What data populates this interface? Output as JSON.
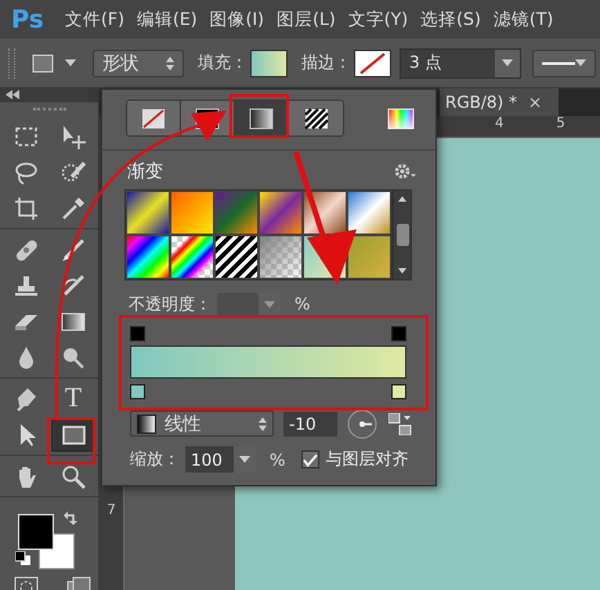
{
  "app_logo": "Ps",
  "menu": [
    "文件(F)",
    "编辑(E)",
    "图像(I)",
    "图层(L)",
    "文字(Y)",
    "选择(S)",
    "滤镜(T)"
  ],
  "options_bar": {
    "mode": "形状",
    "fill_label": "填充：",
    "stroke_label": "描边：",
    "stroke_width": "3 点"
  },
  "tool_groups": [
    [
      {
        "kind": "marquee",
        "selected": false
      },
      {
        "kind": "move",
        "selected": false
      },
      {
        "kind": "lasso",
        "selected": false
      },
      {
        "kind": "quick_select",
        "selected": false
      },
      {
        "kind": "crop",
        "selected": false
      },
      {
        "kind": "eyedropper",
        "selected": false
      }
    ],
    [
      {
        "kind": "healing",
        "selected": false
      },
      {
        "kind": "brush",
        "selected": false
      },
      {
        "kind": "stamp",
        "selected": false
      },
      {
        "kind": "history_brush",
        "selected": false
      },
      {
        "kind": "eraser",
        "selected": false
      },
      {
        "kind": "gradient",
        "selected": false
      },
      {
        "kind": "blur",
        "selected": false
      },
      {
        "kind": "dodge",
        "selected": false
      }
    ],
    [
      {
        "kind": "pen",
        "selected": false
      },
      {
        "kind": "type",
        "glyph": "T",
        "selected": false
      },
      {
        "kind": "path_select",
        "selected": false
      },
      {
        "kind": "rectangle",
        "selected": true
      }
    ],
    [
      {
        "kind": "hand",
        "selected": false
      },
      {
        "kind": "zoom",
        "selected": false
      }
    ]
  ],
  "document_tab": {
    "title": "RGB/8) *",
    "close": "×"
  },
  "rulers": {
    "horizontal": [
      "4",
      "5"
    ],
    "vertical": [
      "7"
    ]
  },
  "fill_panel": {
    "types": [
      {
        "kind": "none",
        "selected": false
      },
      {
        "kind": "solid",
        "selected": false
      },
      {
        "kind": "gradient",
        "selected": true
      },
      {
        "kind": "pattern",
        "selected": false
      }
    ],
    "title": "渐变",
    "opacity_label": "不透明度：",
    "opacity_unit": "%",
    "gradient": {
      "stops": [
        {
          "color": "#80c8c0"
        },
        {
          "color": "#dfe9a0"
        }
      ]
    },
    "style": "线性",
    "angle": "-10",
    "scale_label": "缩放：",
    "scale": "100",
    "scale_unit": "%",
    "align": {
      "label": "与图层对齐",
      "checked": true
    }
  }
}
